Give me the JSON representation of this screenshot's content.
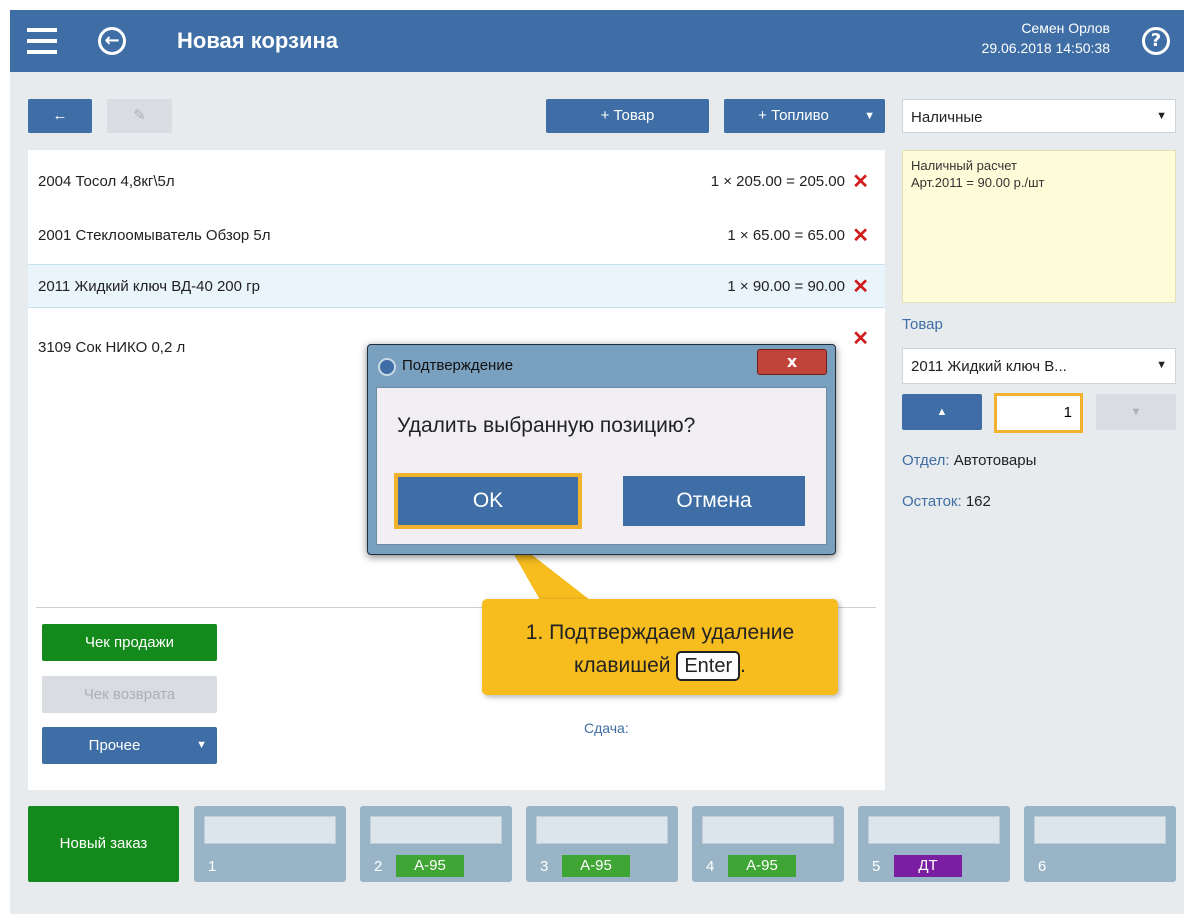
{
  "header": {
    "title": "Новая корзина",
    "user": "Семен Орлов",
    "datetime": "29.06.2018 14:50:38",
    "help": "?",
    "back": "←"
  },
  "toolbar": {
    "back_arrow": "←",
    "edit_icon": "✎",
    "add_item": "+ Товар",
    "add_fuel": "+ Топливо",
    "fuel_arrow": "▼"
  },
  "cart": {
    "items": [
      {
        "name": "2004 Тосол 4,8кг\\5л",
        "calc": "1 × 205.00 = 205.00",
        "del": "✕"
      },
      {
        "name": "2001 Стеклоомыватель Обзор 5л",
        "calc": "1 × 65.00 =  65.00",
        "del": "✕"
      },
      {
        "name": "2011 Жидкий ключ ВД-40 200 гр",
        "calc": "1 × 90.00 =  90.00",
        "del": "✕"
      },
      {
        "name": "3109 Сок НИКО 0,2 л",
        "calc": "",
        "del": "✕"
      }
    ]
  },
  "actions": {
    "sale_check": "Чек продажи",
    "return_check": "Чек возврата",
    "other": "Прочее",
    "other_arrow": "▼",
    "change_label": "Сдача:"
  },
  "payment": {
    "method": "Наличные",
    "arrow": "▼",
    "note_line1": "Наличный расчет",
    "note_line2": "Арт.2011 = 90.00 р./шт"
  },
  "product": {
    "label": "Товар",
    "selected": "2011  Жидкий ключ В...",
    "arrow": "▼",
    "up": "▲",
    "down": "▼",
    "quantity": "1",
    "dept_label": "Отдел:",
    "dept_value": "Автотовары",
    "stock_label": "Остаток:",
    "stock_value": "162"
  },
  "tabs": {
    "new_order": "Новый заказ",
    "items": [
      {
        "num": "1",
        "fuel": "",
        "color": ""
      },
      {
        "num": "2",
        "fuel": "А-95",
        "color": "#3fa535"
      },
      {
        "num": "3",
        "fuel": "А-95",
        "color": "#3fa535"
      },
      {
        "num": "4",
        "fuel": "А-95",
        "color": "#3fa535"
      },
      {
        "num": "5",
        "fuel": "ДТ",
        "color": "#7b1fa2"
      },
      {
        "num": "6",
        "fuel": "",
        "color": ""
      }
    ]
  },
  "dialog": {
    "title": "Подтверждение",
    "close": "x",
    "message": "Удалить выбранную позицию?",
    "ok": "OK",
    "cancel": "Отмена"
  },
  "tooltip": {
    "line1": "1. Подтверждаем удаление",
    "line2_prefix": "клавишей",
    "key": "Enter",
    "line2_suffix": "."
  },
  "colors": {
    "header": "#3e6ea5",
    "accent_green": "#158a1c",
    "tooltip": "#f7bd1f",
    "delete": "#d01c1c"
  }
}
